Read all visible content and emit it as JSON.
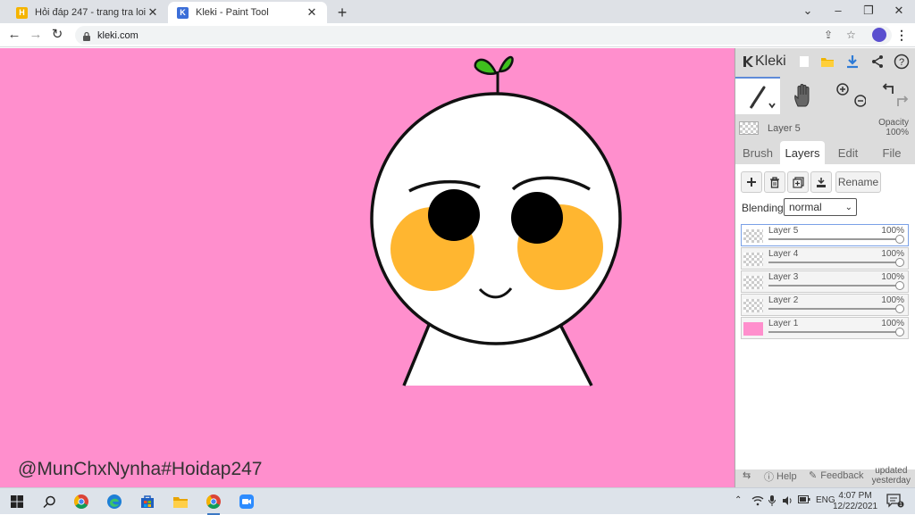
{
  "browser": {
    "tabs": [
      {
        "title": "Hỏi đáp 247 - trang tra loi",
        "icon": "hoidap-favicon"
      },
      {
        "title": "Kleki - Paint Tool",
        "icon": "kleki-favicon"
      }
    ],
    "url": "kleki.com"
  },
  "canvas": {
    "watermark": "@MunChxNynha#Hoidap247",
    "background_color": "#ff8fcd"
  },
  "panel": {
    "brand": "Kleki",
    "current_layer": {
      "name": "Layer 5",
      "opacity_label": "Opacity",
      "opacity_value": "100%"
    },
    "tabs": [
      "Brush",
      "Layers",
      "Edit",
      "File"
    ],
    "active_tab": "Layers",
    "rename_label": "Rename",
    "blending_label": "Blending",
    "blending_value": "normal",
    "layers": [
      {
        "name": "Layer 5",
        "opacity": "100%"
      },
      {
        "name": "Layer 4",
        "opacity": "100%"
      },
      {
        "name": "Layer 3",
        "opacity": "100%"
      },
      {
        "name": "Layer 2",
        "opacity": "100%"
      },
      {
        "name": "Layer 1",
        "opacity": "100%"
      }
    ],
    "footer": {
      "help": "Help",
      "feedback": "Feedback",
      "updated_line1": "updated",
      "updated_line2": "yesterday"
    }
  },
  "taskbar": {
    "language": "ENG",
    "time": "4:07 PM",
    "date": "12/22/2021",
    "notification_count": "1"
  }
}
